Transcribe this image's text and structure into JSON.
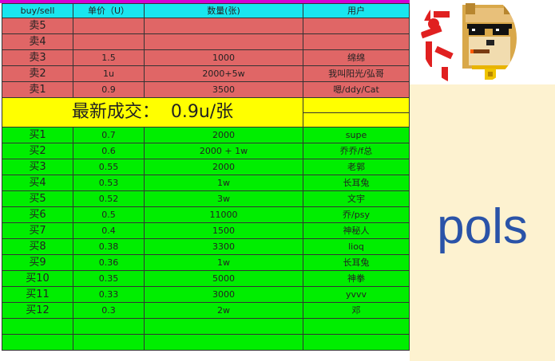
{
  "headers": {
    "side": "buy/sell",
    "price": "单价（U）",
    "qty": "数量(张)",
    "user": "用户"
  },
  "sell_rows": [
    {
      "side": "卖5",
      "price": "",
      "qty": "",
      "user": ""
    },
    {
      "side": "卖4",
      "price": "",
      "qty": "",
      "user": ""
    },
    {
      "side": "卖3",
      "price": "1.5",
      "qty": "1000",
      "user": "绵绵"
    },
    {
      "side": "卖2",
      "price": "1u",
      "qty": "2000+5w",
      "user": "我叫阳光/弘哥"
    },
    {
      "side": "卖1",
      "price": "0.9",
      "qty": "3500",
      "user": "嗯/ddy/Cat"
    }
  ],
  "last_trade": {
    "label": "最新成交：",
    "value": "0.9u/张"
  },
  "buy_rows": [
    {
      "side": "买1",
      "price": "0.7",
      "qty": "2000",
      "user": "supe"
    },
    {
      "side": "买2",
      "price": "0.6",
      "qty": "2000 + 1w",
      "user": "乔乔/f总"
    },
    {
      "side": "买3",
      "price": "0.55",
      "qty": "2000",
      "user": "老郭"
    },
    {
      "side": "买4",
      "price": "0.53",
      "qty": "1w",
      "user": "长耳兔"
    },
    {
      "side": "买5",
      "price": "0.52",
      "qty": "3w",
      "user": "文宇"
    },
    {
      "side": "买6",
      "price": "0.5",
      "qty": "11000",
      "user": "乔/psy"
    },
    {
      "side": "买7",
      "price": "0.4",
      "qty": "1500",
      "user": "神秘人"
    },
    {
      "side": "买8",
      "price": "0.38",
      "qty": "3300",
      "user": "lioq"
    },
    {
      "side": "买9",
      "price": "0.36",
      "qty": "1w",
      "user": "长耳兔"
    },
    {
      "side": "买10",
      "price": "0.35",
      "qty": "5000",
      "user": "神拳"
    },
    {
      "side": "买11",
      "price": "0.33",
      "qty": "3000",
      "user": "yvvv"
    },
    {
      "side": "买12",
      "price": "0.3",
      "qty": "2w",
      "user": "邓"
    },
    {
      "side": "",
      "price": "",
      "qty": "",
      "user": ""
    },
    {
      "side": "",
      "price": "",
      "qty": "",
      "user": ""
    }
  ],
  "brand": "pols",
  "colors": {
    "header": "#19e6ef",
    "sell": "#e06666",
    "buy": "#00ee00",
    "last": "#ffff00",
    "brand": "#2a53a8"
  },
  "logo": {
    "icon": "doge-with-sunglasses-avatar"
  }
}
